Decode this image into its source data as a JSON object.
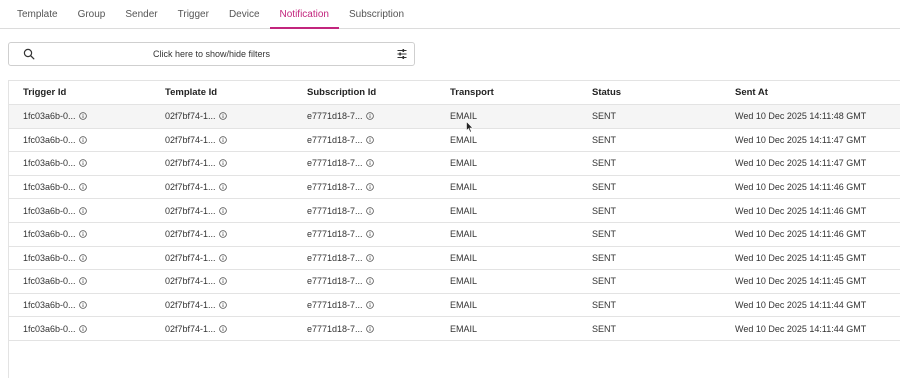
{
  "tabs": [
    {
      "label": "Template"
    },
    {
      "label": "Group"
    },
    {
      "label": "Sender"
    },
    {
      "label": "Trigger"
    },
    {
      "label": "Device"
    },
    {
      "label": "Notification",
      "active": true
    },
    {
      "label": "Subscription"
    }
  ],
  "filter": {
    "text": "Click here to show/hide filters"
  },
  "table": {
    "columns": [
      "Trigger Id",
      "Template Id",
      "Subscription Id",
      "Transport",
      "Status",
      "Sent At"
    ],
    "rows": [
      [
        "1fc03a6b-0...",
        "02f7bf74-1...",
        "e7771d18-7...",
        "EMAIL",
        "SENT",
        "Wed 10 Dec 2025 14:11:48 GMT"
      ],
      [
        "1fc03a6b-0...",
        "02f7bf74-1...",
        "e7771d18-7...",
        "EMAIL",
        "SENT",
        "Wed 10 Dec 2025 14:11:47 GMT"
      ],
      [
        "1fc03a6b-0...",
        "02f7bf74-1...",
        "e7771d18-7...",
        "EMAIL",
        "SENT",
        "Wed 10 Dec 2025 14:11:47 GMT"
      ],
      [
        "1fc03a6b-0...",
        "02f7bf74-1...",
        "e7771d18-7...",
        "EMAIL",
        "SENT",
        "Wed 10 Dec 2025 14:11:46 GMT"
      ],
      [
        "1fc03a6b-0...",
        "02f7bf74-1...",
        "e7771d18-7...",
        "EMAIL",
        "SENT",
        "Wed 10 Dec 2025 14:11:46 GMT"
      ],
      [
        "1fc03a6b-0...",
        "02f7bf74-1...",
        "e7771d18-7...",
        "EMAIL",
        "SENT",
        "Wed 10 Dec 2025 14:11:46 GMT"
      ],
      [
        "1fc03a6b-0...",
        "02f7bf74-1...",
        "e7771d18-7...",
        "EMAIL",
        "SENT",
        "Wed 10 Dec 2025 14:11:45 GMT"
      ],
      [
        "1fc03a6b-0...",
        "02f7bf74-1...",
        "e7771d18-7...",
        "EMAIL",
        "SENT",
        "Wed 10 Dec 2025 14:11:45 GMT"
      ],
      [
        "1fc03a6b-0...",
        "02f7bf74-1...",
        "e7771d18-7...",
        "EMAIL",
        "SENT",
        "Wed 10 Dec 2025 14:11:44 GMT"
      ],
      [
        "1fc03a6b-0...",
        "02f7bf74-1...",
        "e7771d18-7...",
        "EMAIL",
        "SENT",
        "Wed 10 Dec 2025 14:11:44 GMT"
      ]
    ]
  },
  "icons": {
    "search": "search-icon",
    "filter": "sliders-icon",
    "info": "info-icon"
  },
  "colors": {
    "accent": "#c2257d",
    "hover_row": "#f5f5f5",
    "border": "#e3e3e3"
  }
}
